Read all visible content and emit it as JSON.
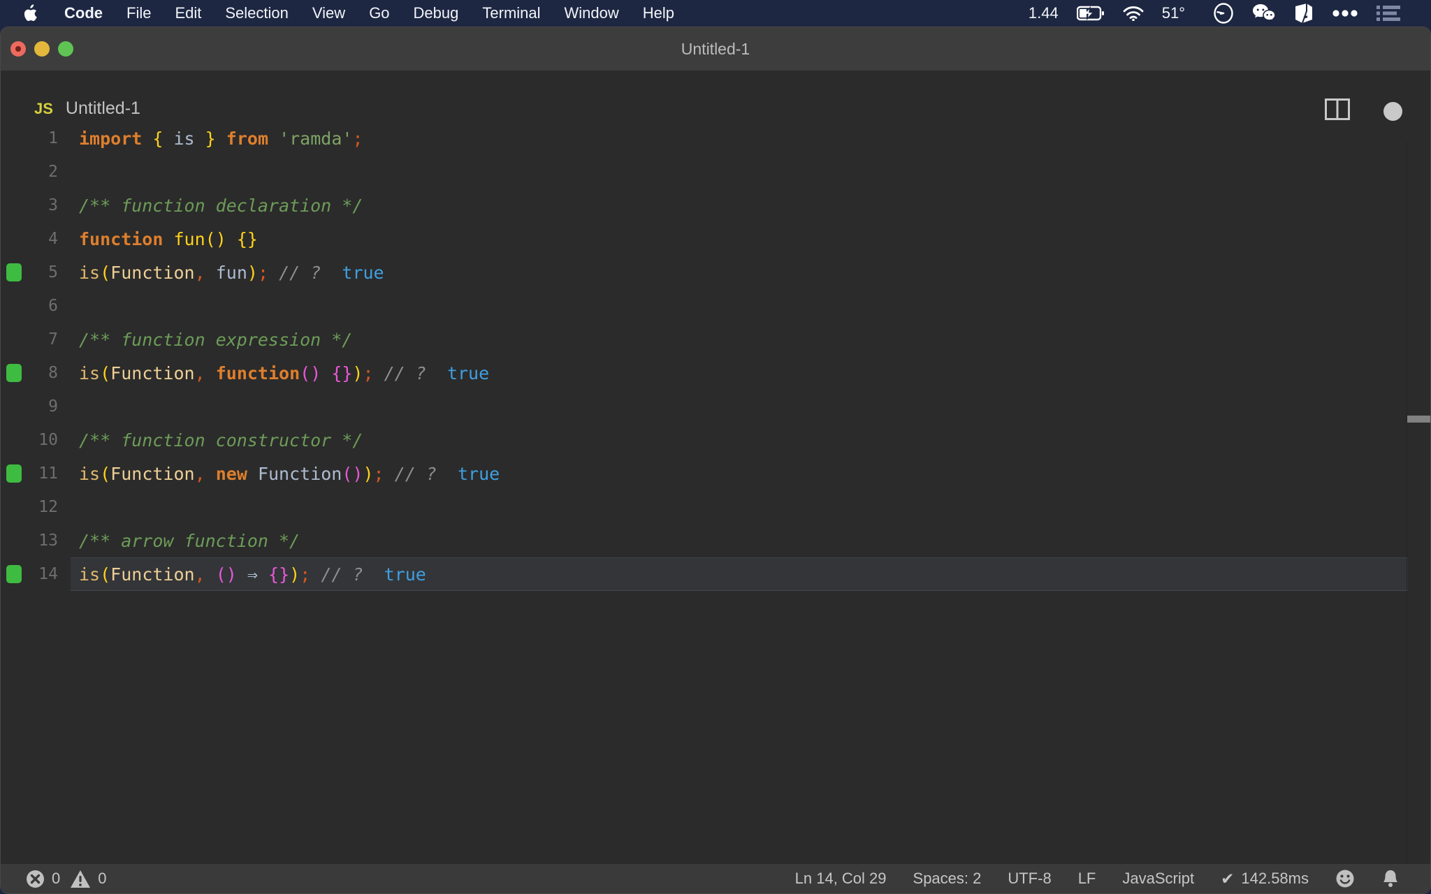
{
  "menubar": {
    "items": [
      {
        "label": "Code",
        "bold": true
      },
      {
        "label": "File"
      },
      {
        "label": "Edit"
      },
      {
        "label": "Selection"
      },
      {
        "label": "View"
      },
      {
        "label": "Go"
      },
      {
        "label": "Debug"
      },
      {
        "label": "Terminal"
      },
      {
        "label": "Window"
      },
      {
        "label": "Help"
      }
    ],
    "status": {
      "left_value": "1.44",
      "temperature": "51°",
      "icons": [
        "apple-logo",
        "battery-charging-icon",
        "wifi-icon",
        "clock-icon",
        "wechat-icon",
        "notes-app-icon",
        "more-dots-icon",
        "list-menu-icon"
      ]
    }
  },
  "window": {
    "title": "Untitled-1",
    "tab": {
      "badge": "JS",
      "label": "Untitled-1"
    },
    "actions": {
      "split_editor": "split-editor-icon",
      "dirty": "unsaved-dot"
    }
  },
  "editor": {
    "lines": [
      {
        "num": "1",
        "marker": false,
        "current": false,
        "tokens": [
          {
            "t": "import",
            "c": "kw"
          },
          {
            "t": " ",
            "c": "pl"
          },
          {
            "t": "{",
            "c": "y"
          },
          {
            "t": " ",
            "c": "pl"
          },
          {
            "t": "is",
            "c": "id"
          },
          {
            "t": " ",
            "c": "pl"
          },
          {
            "t": "}",
            "c": "y"
          },
          {
            "t": " ",
            "c": "pl"
          },
          {
            "t": "from",
            "c": "kw"
          },
          {
            "t": " ",
            "c": "pl"
          },
          {
            "t": "'ramda'",
            "c": "str"
          },
          {
            "t": ";",
            "c": "pu"
          }
        ]
      },
      {
        "num": "2",
        "marker": false,
        "current": false,
        "tokens": []
      },
      {
        "num": "3",
        "marker": false,
        "current": false,
        "tokens": [
          {
            "t": "/** function declaration */",
            "c": "cm"
          }
        ]
      },
      {
        "num": "4",
        "marker": false,
        "current": false,
        "tokens": [
          {
            "t": "function",
            "c": "kw"
          },
          {
            "t": " ",
            "c": "pl"
          },
          {
            "t": "fun",
            "c": "fn"
          },
          {
            "t": "()",
            "c": "y"
          },
          {
            "t": " ",
            "c": "pl"
          },
          {
            "t": "{}",
            "c": "y"
          }
        ]
      },
      {
        "num": "5",
        "marker": true,
        "current": false,
        "tokens": [
          {
            "t": "is",
            "c": "call"
          },
          {
            "t": "(",
            "c": "y"
          },
          {
            "t": "Function",
            "c": "bi"
          },
          {
            "t": ",",
            "c": "pu"
          },
          {
            "t": " ",
            "c": "pl"
          },
          {
            "t": "fun",
            "c": "id"
          },
          {
            "t": ")",
            "c": "y"
          },
          {
            "t": ";",
            "c": "pu"
          },
          {
            "t": " ",
            "c": "pl"
          },
          {
            "t": "// ?",
            "c": "lc"
          },
          {
            "t": "  ",
            "c": "pl"
          },
          {
            "t": "true",
            "c": "res"
          }
        ]
      },
      {
        "num": "6",
        "marker": false,
        "current": false,
        "tokens": []
      },
      {
        "num": "7",
        "marker": false,
        "current": false,
        "tokens": [
          {
            "t": "/** function expression */",
            "c": "cm"
          }
        ]
      },
      {
        "num": "8",
        "marker": true,
        "current": false,
        "tokens": [
          {
            "t": "is",
            "c": "call"
          },
          {
            "t": "(",
            "c": "y"
          },
          {
            "t": "Function",
            "c": "bi"
          },
          {
            "t": ",",
            "c": "pu"
          },
          {
            "t": " ",
            "c": "pl"
          },
          {
            "t": "function",
            "c": "kw"
          },
          {
            "t": "()",
            "c": "pk"
          },
          {
            "t": " ",
            "c": "pl"
          },
          {
            "t": "{}",
            "c": "pk"
          },
          {
            "t": ")",
            "c": "y"
          },
          {
            "t": ";",
            "c": "pu"
          },
          {
            "t": " ",
            "c": "pl"
          },
          {
            "t": "// ?",
            "c": "lc"
          },
          {
            "t": "  ",
            "c": "pl"
          },
          {
            "t": "true",
            "c": "res"
          }
        ]
      },
      {
        "num": "9",
        "marker": false,
        "current": false,
        "tokens": []
      },
      {
        "num": "10",
        "marker": false,
        "current": false,
        "tokens": [
          {
            "t": "/** function constructor */",
            "c": "cm"
          }
        ]
      },
      {
        "num": "11",
        "marker": true,
        "current": false,
        "tokens": [
          {
            "t": "is",
            "c": "call"
          },
          {
            "t": "(",
            "c": "y"
          },
          {
            "t": "Function",
            "c": "bi"
          },
          {
            "t": ",",
            "c": "pu"
          },
          {
            "t": " ",
            "c": "pl"
          },
          {
            "t": "new",
            "c": "kw"
          },
          {
            "t": " ",
            "c": "pl"
          },
          {
            "t": "Function",
            "c": "id"
          },
          {
            "t": "()",
            "c": "pk"
          },
          {
            "t": ")",
            "c": "y"
          },
          {
            "t": ";",
            "c": "pu"
          },
          {
            "t": " ",
            "c": "pl"
          },
          {
            "t": "// ?",
            "c": "lc"
          },
          {
            "t": "  ",
            "c": "pl"
          },
          {
            "t": "true",
            "c": "res"
          }
        ]
      },
      {
        "num": "12",
        "marker": false,
        "current": false,
        "tokens": []
      },
      {
        "num": "13",
        "marker": false,
        "current": false,
        "tokens": [
          {
            "t": "/** arrow function */",
            "c": "cm"
          }
        ]
      },
      {
        "num": "14",
        "marker": true,
        "current": true,
        "tokens": [
          {
            "t": "is",
            "c": "call"
          },
          {
            "t": "(",
            "c": "y"
          },
          {
            "t": "Function",
            "c": "bi"
          },
          {
            "t": ",",
            "c": "pu"
          },
          {
            "t": " ",
            "c": "pl"
          },
          {
            "t": "()",
            "c": "pk"
          },
          {
            "t": " ",
            "c": "pl"
          },
          {
            "t": "⇒",
            "c": "ar"
          },
          {
            "t": " ",
            "c": "pl"
          },
          {
            "t": "{}",
            "c": "pk"
          },
          {
            "t": ")",
            "c": "y"
          },
          {
            "t": ";",
            "c": "pu"
          },
          {
            "t": " ",
            "c": "pl"
          },
          {
            "t": "// ?",
            "c": "lc"
          },
          {
            "t": "  ",
            "c": "pl"
          },
          {
            "t": "true",
            "c": "res"
          }
        ]
      }
    ]
  },
  "statusbar": {
    "errors": "0",
    "warnings": "0",
    "cursor": "Ln 14, Col 29",
    "indent": "Spaces: 2",
    "encoding": "UTF-8",
    "eol": "LF",
    "language": "JavaScript",
    "perf_check": "✔",
    "perf": "142.58ms"
  },
  "colors": {
    "menubar_bg": "#1d2742",
    "editor_bg": "#2b2b2b",
    "coverage_green": "#3ebc41",
    "result_blue": "#3f9fe0",
    "keyword_orange": "#de7f2d",
    "bracket_yellow": "#ffd21c",
    "bracket_pink": "#ea57d9",
    "comment_green": "#6d9c58",
    "js_badge_yellow": "#d6cf3e"
  }
}
